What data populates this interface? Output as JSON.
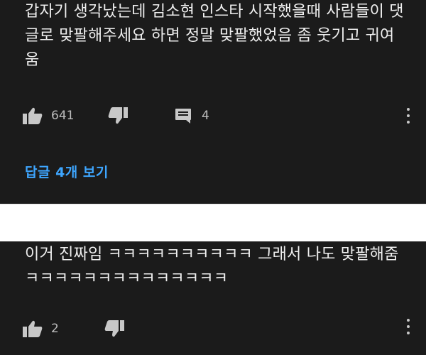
{
  "comments": [
    {
      "text": "갑자기 생각났는데 김소현 인스타 시작했을때 사람들이 댓글로 맞팔해주세요 하면 정말 맞팔했었음 좀 웃기고 귀여움",
      "likes": "641",
      "replies": "4",
      "view_replies": "답글 4개 보기"
    },
    {
      "text": "이거 진짜임 ㅋㅋㅋㅋㅋㅋㅋㅋㅋㅋ 그래서 나도 맞팔해줌 ㅋㅋㅋㅋㅋㅋㅋㅋㅋㅋㅋㅋㅋㅋ",
      "likes": "2"
    }
  ],
  "icons": {
    "like": "thumbs-up-icon",
    "dislike": "thumbs-down-icon",
    "reply": "comment-icon",
    "menu": "more-vertical-icon"
  },
  "colors": {
    "background": "#1b1b1b",
    "text": "#eeeeee",
    "secondary": "#bdbdbd",
    "link": "#3ea6ff",
    "divider": "#ffffff"
  }
}
